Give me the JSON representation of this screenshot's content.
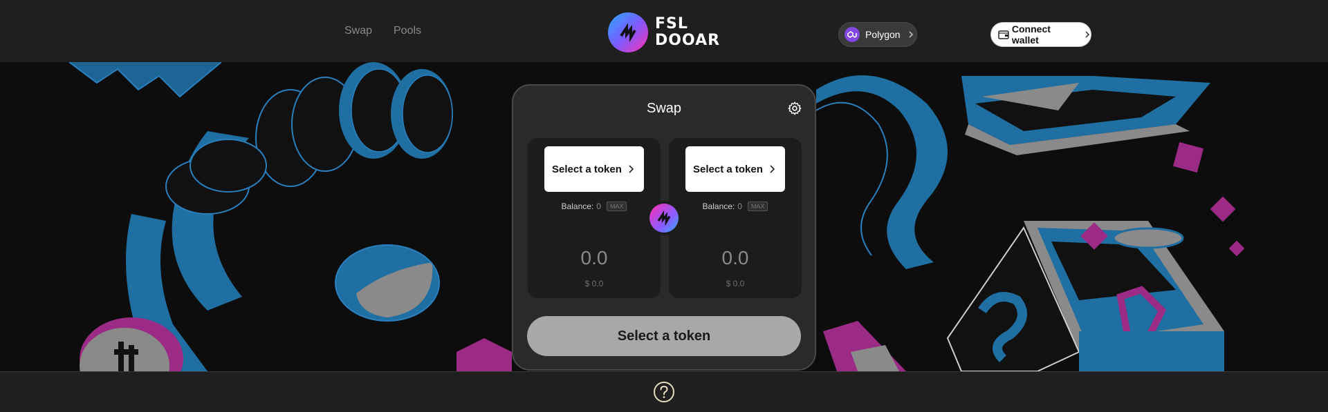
{
  "nav": {
    "links": [
      "Swap",
      "Pools"
    ],
    "logo_line1": "FSL",
    "logo_line2": "DOOAR",
    "network_label": "Polygon",
    "connect_label": "Connect wallet"
  },
  "swap": {
    "title": "Swap",
    "from": {
      "token_label": "Select a token",
      "balance_label": "Balance:",
      "balance_value": "0",
      "max_label": "MAX",
      "amount": "0.0",
      "usd": "$ 0.0"
    },
    "to": {
      "token_label": "Select a token",
      "balance_label": "Balance:",
      "balance_value": "0",
      "max_label": "MAX",
      "amount": "0.0",
      "usd": "$ 0.0"
    },
    "action_label": "Select a token"
  },
  "icons": {
    "settings": "gear-icon",
    "switch": "swap-arrows-icon",
    "help": "question-circle-icon",
    "network": "polygon-icon",
    "wallet": "wallet-icon"
  },
  "colors": {
    "accent_pink": "#ff2fb3",
    "accent_blue": "#2aa8ff",
    "art_blue": "#1f6fa3",
    "art_magenta": "#9c2b86",
    "polygon_purple": "#8247e5"
  }
}
